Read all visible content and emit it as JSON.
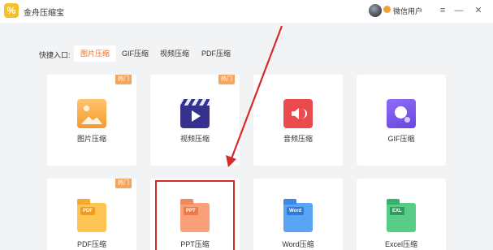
{
  "window": {
    "app_title": "金舟压缩宝",
    "logo_glyph": "%",
    "user_name": "微信用户",
    "controls": {
      "menu": "≡",
      "minimize": "—",
      "close": "✕"
    }
  },
  "quick_entry": {
    "label": "快捷入口:",
    "tabs": [
      {
        "label": "图片压缩",
        "active": true
      },
      {
        "label": "GIF压缩",
        "active": false
      },
      {
        "label": "视频压缩",
        "active": false
      },
      {
        "label": "PDF压缩",
        "active": false
      }
    ]
  },
  "cards": [
    {
      "label": "图片压缩",
      "icon": "image-icon",
      "badge": "热门"
    },
    {
      "label": "视频压缩",
      "icon": "video-icon",
      "badge": "热门"
    },
    {
      "label": "音频压缩",
      "icon": "audio-icon",
      "badge": ""
    },
    {
      "label": "GIF压缩",
      "icon": "gif-icon",
      "badge": ""
    },
    {
      "label": "PDF压缩",
      "icon": "pdf-icon",
      "tag": "PDF",
      "badge": "热门"
    },
    {
      "label": "PPT压缩",
      "icon": "ppt-icon",
      "tag": "PPT",
      "badge": ""
    },
    {
      "label": "Word压缩",
      "icon": "word-icon",
      "tag": "Word",
      "badge": ""
    },
    {
      "label": "Excel压缩",
      "icon": "excel-icon",
      "tag": "EXL",
      "badge": ""
    }
  ],
  "colors": {
    "accent": "#f26a1b",
    "hot_badge": "#f6a55c",
    "annotation": "#d52b2b"
  }
}
